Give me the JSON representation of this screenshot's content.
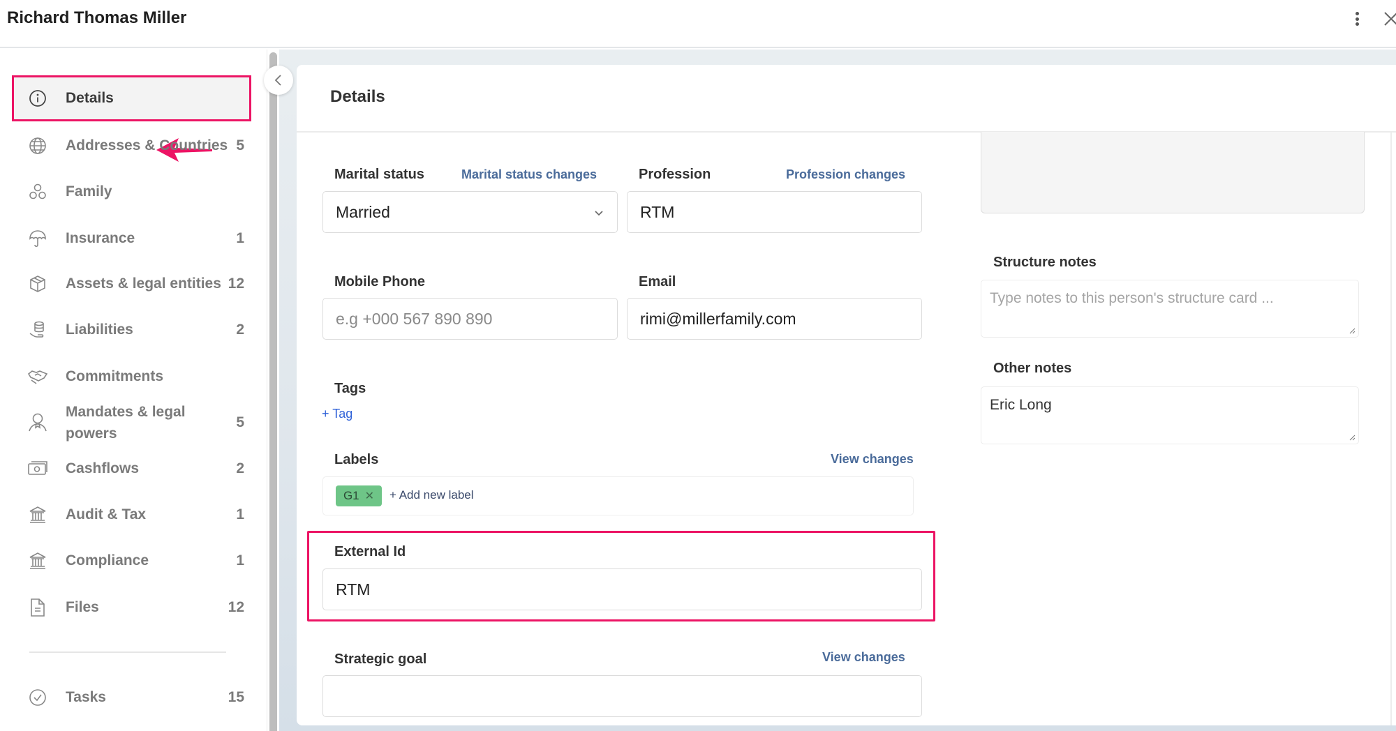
{
  "window": {
    "title": "Richard Thomas Miller",
    "more_icon": "kebab-vertical-icon",
    "close_icon": "close-icon"
  },
  "sidebar": {
    "items": [
      {
        "label": "Details",
        "count": "",
        "icon": "info-icon",
        "active": true
      },
      {
        "label": "Addresses & Countries",
        "count": "5",
        "icon": "globe-icon"
      },
      {
        "label": "Family",
        "count": "",
        "icon": "family-icon"
      },
      {
        "label": "Insurance",
        "count": "1",
        "icon": "umbrella-icon"
      },
      {
        "label": "Assets & legal entities",
        "count": "12",
        "icon": "box-icon"
      },
      {
        "label": "Liabilities",
        "count": "2",
        "icon": "coins-hand-icon"
      },
      {
        "label": "Commitments",
        "count": "",
        "icon": "handshake-icon"
      },
      {
        "label": "Mandates & legal powers",
        "count": "5",
        "icon": "award-person-icon"
      },
      {
        "label": "Cashflows",
        "count": "2",
        "icon": "cash-icon"
      },
      {
        "label": "Audit & Tax",
        "count": "1",
        "icon": "bank-icon"
      },
      {
        "label": "Compliance",
        "count": "1",
        "icon": "bank-icon"
      },
      {
        "label": "Files",
        "count": "12",
        "icon": "file-icon"
      }
    ],
    "tasks": {
      "label": "Tasks",
      "count": "15",
      "icon": "check-circle-icon"
    },
    "collapse_icon": "chevron-left-icon"
  },
  "main": {
    "title": "Details",
    "marital_status": {
      "label": "Marital status",
      "link": "Marital status changes",
      "value": "Married"
    },
    "profession": {
      "label": "Profession",
      "link": "Profession changes",
      "value": "RTM"
    },
    "mobile_phone": {
      "label": "Mobile Phone",
      "value": "",
      "placeholder": "e.g +000 567 890 890"
    },
    "email": {
      "label": "Email",
      "value": "rimi@millerfamily.com"
    },
    "tags": {
      "label": "Tags",
      "add": "+ Tag"
    },
    "labels": {
      "label": "Labels",
      "link": "View changes",
      "chips": [
        "G1"
      ],
      "add": "+ Add new label"
    },
    "external_id": {
      "label": "External Id",
      "value": "RTM"
    },
    "strategic_goal": {
      "label": "Strategic goal",
      "link": "View changes",
      "value": ""
    },
    "structure_notes": {
      "label": "Structure notes",
      "value": "",
      "placeholder": "Type notes to this person's structure card ..."
    },
    "other_notes": {
      "label": "Other notes",
      "value": "Eric Long"
    }
  },
  "colors": {
    "highlight": "#ec1464",
    "link": "#4a6b9a",
    "chip_bg": "#6ec587",
    "tag_link": "#2f62d8"
  }
}
